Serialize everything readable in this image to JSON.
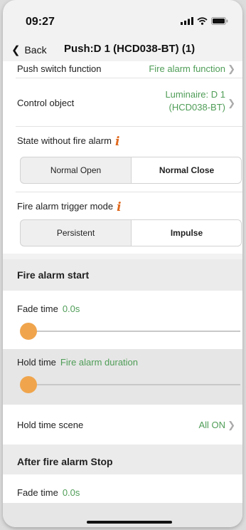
{
  "status": {
    "time": "09:27"
  },
  "nav": {
    "back_label": "Back",
    "title": "Push:D 1 (HCD038-BT) (1)"
  },
  "rows": {
    "push_switch": {
      "label": "Push switch function",
      "value": "Fire alarm function"
    },
    "control_object": {
      "label": "Control object",
      "value_line1": "Luminaire: D 1",
      "value_line2": "(HCD038-BT)"
    },
    "state_without_alarm": {
      "label": "State without fire alarm"
    },
    "trigger_mode": {
      "label": "Fire alarm trigger mode"
    },
    "hold_time_scene": {
      "label": "Hold time scene",
      "value": "All ON"
    }
  },
  "state_segment": {
    "options": [
      "Normal Open",
      "Normal Close"
    ],
    "selected": "Normal Close"
  },
  "trigger_segment": {
    "options": [
      "Persistent",
      "Impulse"
    ],
    "selected": "Impulse"
  },
  "sections": {
    "fire_alarm_start": {
      "title": "Fire alarm start",
      "fade_time": {
        "label": "Fade time",
        "value": "0.0s",
        "slider_fraction": 0
      },
      "hold_time": {
        "label": "Hold time",
        "value": "Fire alarm duration",
        "slider_fraction": 0
      }
    },
    "after_stop": {
      "title": "After fire alarm Stop",
      "fade_time": {
        "label": "Fade time",
        "value": "0.0s"
      }
    }
  },
  "colors": {
    "accent_green": "#4f9d57",
    "info_icon": "#e06a1f",
    "slider_thumb": "#f0a54d"
  },
  "icons": [
    "cellular-signal-icon",
    "wifi-icon",
    "battery-icon",
    "chevron-left-icon",
    "chevron-right-icon",
    "info-icon"
  ]
}
